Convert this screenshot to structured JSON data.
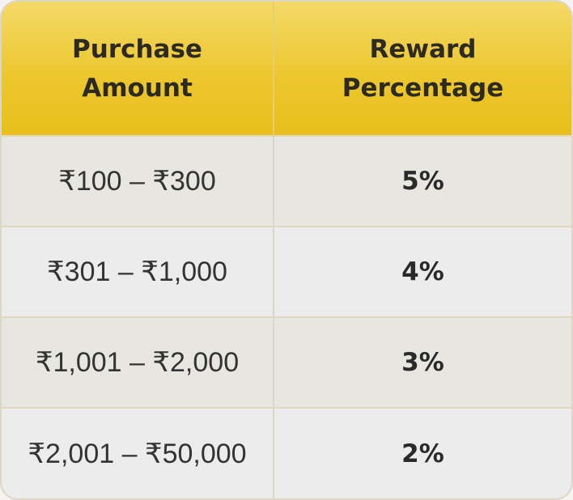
{
  "table": {
    "headers": [
      {
        "line1": "Purchase",
        "line2": "Amount"
      },
      {
        "line1": "Reward",
        "line2": "Percentage"
      }
    ],
    "rows": [
      {
        "amount": "₹100 – ₹300",
        "reward": "5%"
      },
      {
        "amount": "₹301 – ₹1,000",
        "reward": "4%"
      },
      {
        "amount": "₹1,001 – ₹2,000",
        "reward": "3%"
      },
      {
        "amount": "₹2,001 – ₹50,000",
        "reward": "2%"
      }
    ]
  },
  "colors": {
    "header_gold": "#ecc72e",
    "row_light": "#e8e6e1",
    "row_alt": "#ececec",
    "text_dark": "#2c2a22"
  }
}
